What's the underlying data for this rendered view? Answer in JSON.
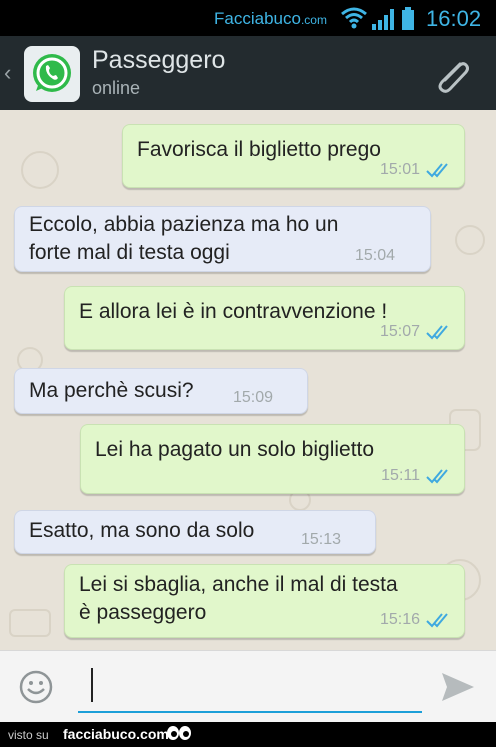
{
  "statusbar": {
    "brand": "Facciabuco",
    "brand_tld": ".com",
    "time": "16:02"
  },
  "header": {
    "contact_name": "Passeggero",
    "contact_status": "online",
    "back": "‹"
  },
  "messages": [
    {
      "dir": "out",
      "lines": [
        "Favorisca il biglietto prego"
      ],
      "time": "15:01"
    },
    {
      "dir": "in",
      "lines": [
        "Eccolo, abbia pazienza ma ho un",
        "forte mal di testa oggi"
      ],
      "time": "15:04"
    },
    {
      "dir": "out",
      "lines": [
        "E allora lei è in contravvenzione !"
      ],
      "time": "15:07"
    },
    {
      "dir": "in",
      "lines": [
        "Ma perchè scusi?"
      ],
      "time": "15:09"
    },
    {
      "dir": "out",
      "lines": [
        "Lei ha pagato un solo biglietto"
      ],
      "time": "15:11"
    },
    {
      "dir": "in",
      "lines": [
        "Esatto, ma sono da solo"
      ],
      "time": "15:13"
    },
    {
      "dir": "out",
      "lines": [
        "Lei si sbaglia, anche il mal di testa",
        "è passeggero"
      ],
      "time": "15:16"
    }
  ],
  "input": {
    "value": "",
    "placeholder": ""
  },
  "footer": {
    "visto": "visto su",
    "site": "facciabuco.com"
  },
  "colors": {
    "outgoing": "#e1f7cb",
    "incoming": "#e6ebf7",
    "ticks": "#3fa9e0",
    "header": "#232b2f",
    "accent": "#1c9fd8"
  },
  "icons": [
    "whatsapp-logo-icon",
    "paperclip-icon",
    "emoji-icon",
    "send-icon",
    "double-check-icon",
    "wifi-icon",
    "signal-icon",
    "battery-icon"
  ]
}
